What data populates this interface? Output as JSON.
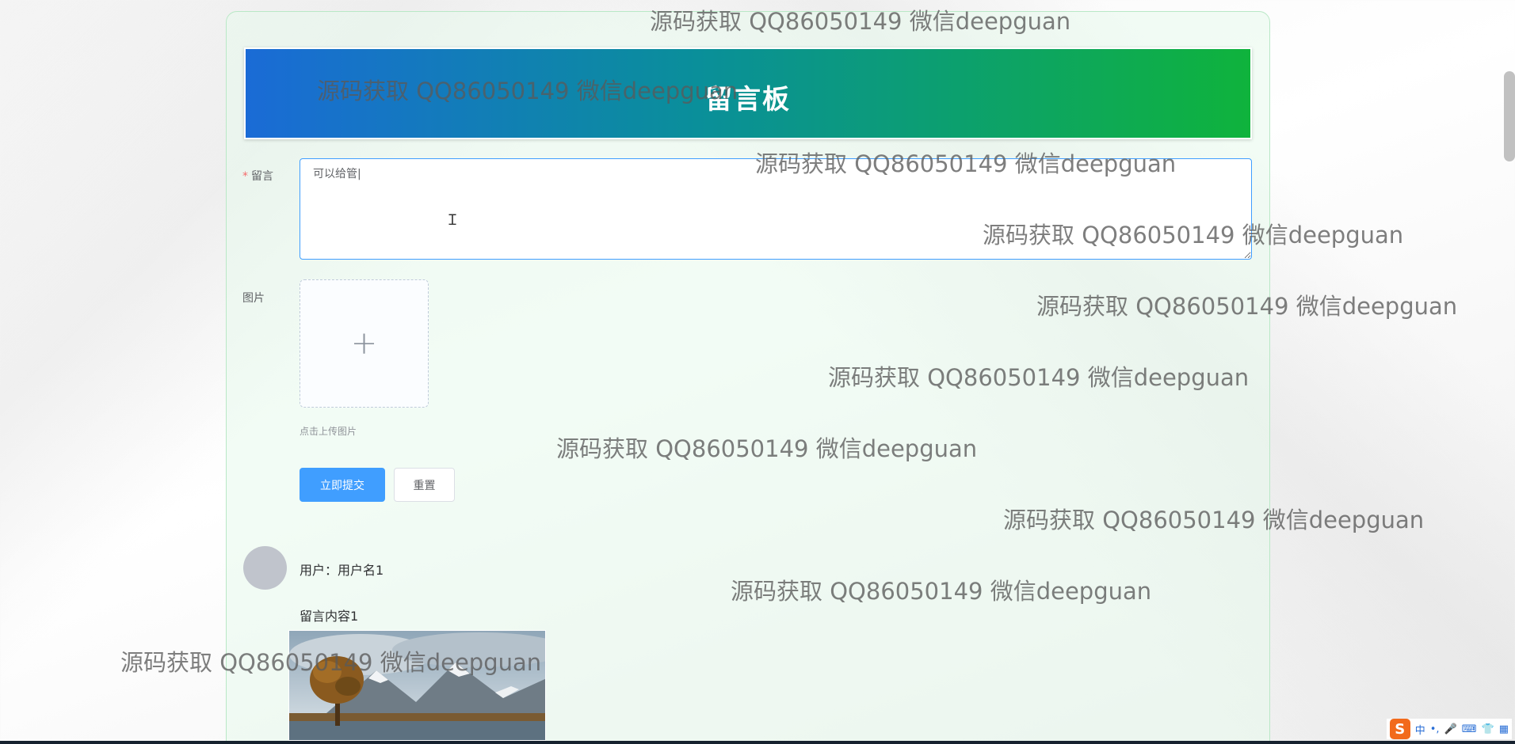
{
  "page": {
    "banner_title": "留言板"
  },
  "form": {
    "message_label": "留言",
    "required_mark": "*",
    "message_value": "可以给管|",
    "image_label": "图片",
    "upload_tip": "点击上传图片",
    "upload_icon": "plus-icon",
    "submit_label": "立即提交",
    "reset_label": "重置"
  },
  "comments": [
    {
      "user_line": "用户：用户名1",
      "content": "留言内容1"
    }
  ],
  "watermark": "源码获取 QQ86050149 微信deepguan",
  "tray": {
    "ime_logo": "S",
    "ime_mode": "中"
  },
  "colors": {
    "primary": "#409eff",
    "banner_start": "#1a6bd6",
    "banner_end": "#0fb33c",
    "required": "#f56c6c"
  }
}
